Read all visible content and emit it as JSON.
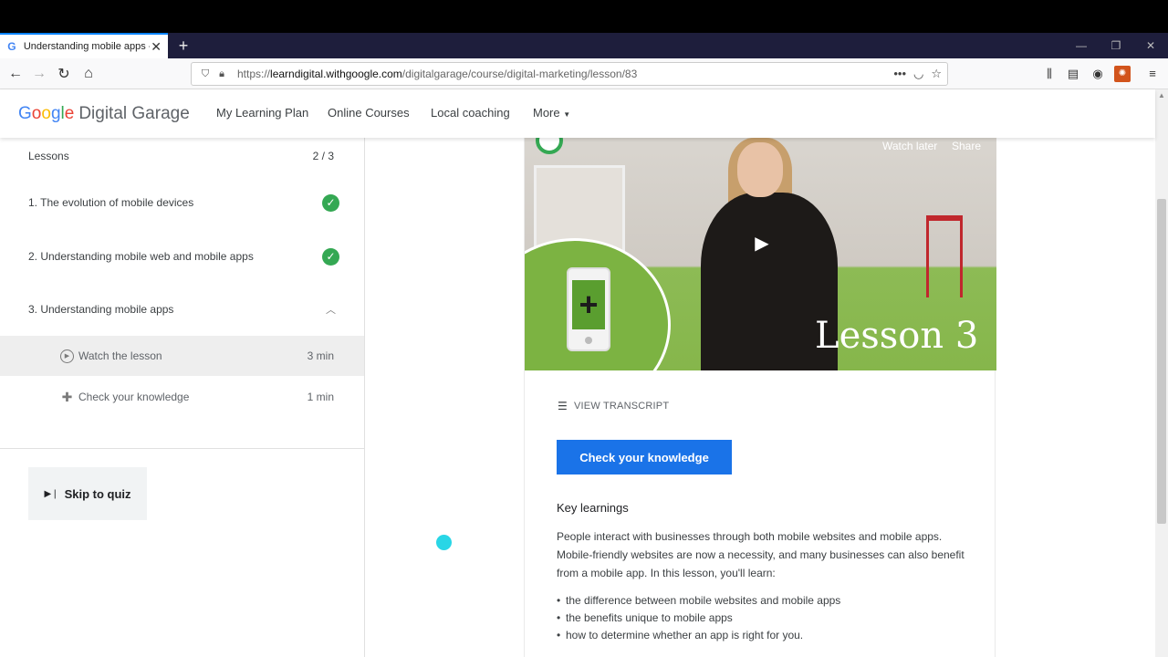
{
  "browser": {
    "tab_title": "Understanding mobile apps - G",
    "tab_favicon": "G",
    "new_tab": "+",
    "url_prefix": "https://",
    "url_domain": "learndigital.withgoogle.com",
    "url_path": "/digitalgarage/course/digital-marketing/lesson/83"
  },
  "site": {
    "logo_google": [
      "G",
      "o",
      "o",
      "g",
      "l",
      "e"
    ],
    "logo_product": "Digital Garage",
    "nav": [
      "My Learning Plan",
      "Online Courses",
      "Local coaching",
      "More"
    ]
  },
  "sidebar": {
    "lessons_label": "Lessons",
    "progress": "2 / 3",
    "lessons": [
      {
        "title": "1. The evolution of mobile devices",
        "state": "complete"
      },
      {
        "title": "2. Understanding mobile web and mobile apps",
        "state": "complete"
      },
      {
        "title": "3. Understanding mobile apps",
        "state": "expanded"
      }
    ],
    "sub_items": [
      {
        "label": "Watch the lesson",
        "duration": "3 min",
        "icon": "play-circle-icon"
      },
      {
        "label": "Check your knowledge",
        "duration": "1 min",
        "icon": "puzzle-icon"
      }
    ],
    "skip_label": "Skip to quiz"
  },
  "video": {
    "watch_later": "Watch later",
    "share": "Share",
    "overlay_title": "Lesson 3"
  },
  "content": {
    "transcript_label": "VIEW TRANSCRIPT",
    "check_button": "Check your knowledge",
    "key_heading": "Key learnings",
    "paragraph": "People interact with businesses through both mobile websites and mobile apps. Mobile-friendly websites are now a necessity, and many businesses can also benefit from a mobile app. In this lesson, you'll learn:",
    "bullets": [
      "the difference between mobile websites and mobile apps",
      "the benefits unique to mobile apps",
      "how to determine whether an app is right for you."
    ]
  },
  "colors": {
    "primary_blue": "#1a73e8",
    "check_green": "#34a853",
    "lesson_green": "#7cb342"
  }
}
